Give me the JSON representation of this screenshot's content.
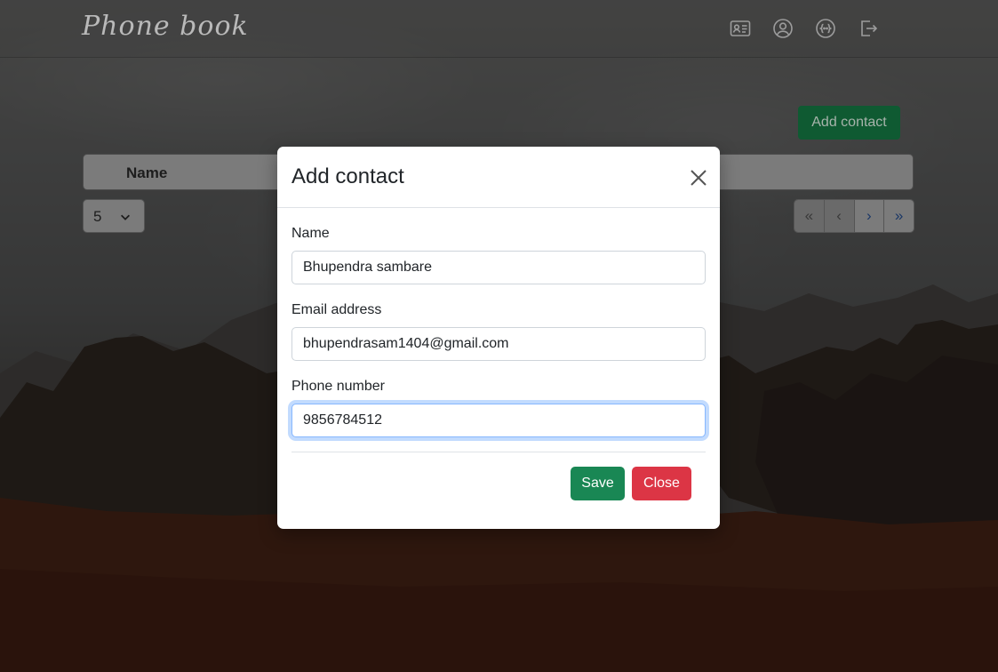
{
  "app": {
    "brand": "Phone book",
    "nav_icons": [
      "contact-card-icon",
      "user-circle-icon",
      "api-icon",
      "logout-icon"
    ]
  },
  "page": {
    "add_contact_label": "Add contact",
    "table": {
      "columns": [
        "Name"
      ]
    },
    "page_size": "5",
    "pagination": [
      "«",
      "‹",
      "›",
      "»"
    ]
  },
  "modal": {
    "title": "Add contact",
    "fields": [
      {
        "label": "Name",
        "value": "Bhupendra sambare"
      },
      {
        "label": "Email address",
        "value": "bhupendrasam1404@gmail.com"
      },
      {
        "label": "Phone number",
        "value": "9856784512"
      }
    ],
    "save_label": "Save",
    "close_label": "Close"
  },
  "colors": {
    "save": "#198754",
    "close": "#dc3545",
    "add_contact": "#198754",
    "focus_ring": "#86b7fe"
  }
}
